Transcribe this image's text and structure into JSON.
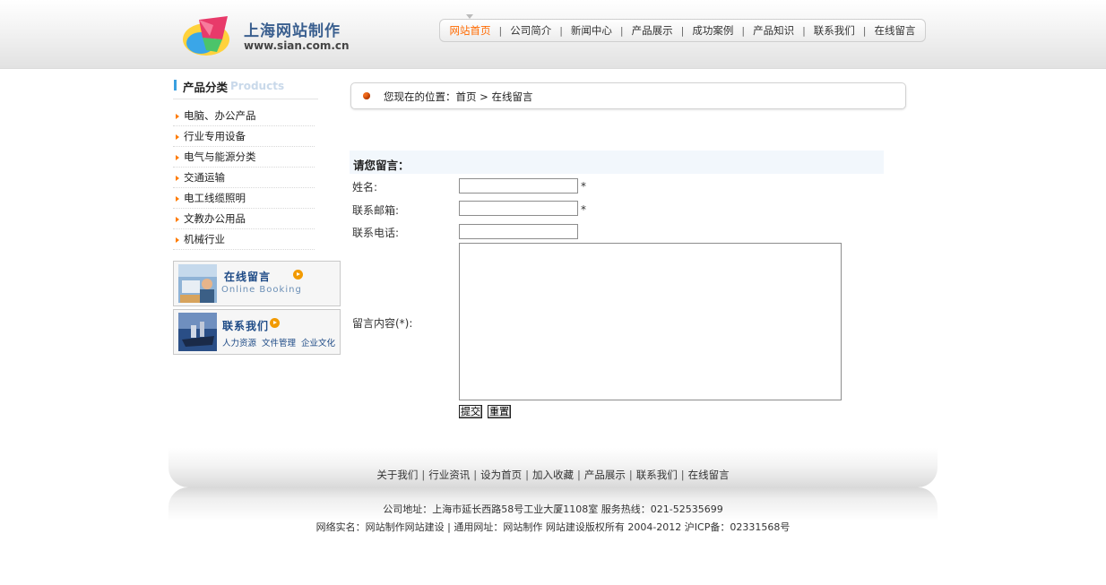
{
  "brand": {
    "title": "上海网站制作",
    "url": "www.sian.com.cn"
  },
  "nav": {
    "items": [
      {
        "label": "网站首页",
        "active": true
      },
      {
        "label": "公司简介"
      },
      {
        "label": "新闻中心"
      },
      {
        "label": "产品展示"
      },
      {
        "label": "成功案例"
      },
      {
        "label": "产品知识"
      },
      {
        "label": "联系我们"
      },
      {
        "label": "在线留言"
      }
    ],
    "separator": "|"
  },
  "sidebar": {
    "heading": "产品分类",
    "heading_en": "Products",
    "categories": [
      "电脑、办公产品",
      "行业专用设备",
      "电气与能源分类",
      "交通运输",
      "电工线缆照明",
      "文教办公用品",
      "机械行业"
    ],
    "promo_booking": {
      "title": "在线留言",
      "subtitle": "Online Booking"
    },
    "promo_contact": {
      "title": "联系我们",
      "links": [
        "人力资源",
        "文件管理",
        "企业文化"
      ]
    }
  },
  "breadcrumb": {
    "prefix": "您现在的位置：",
    "home": "首页",
    "arrow": ">",
    "current": "在线留言"
  },
  "form": {
    "heading": "请您留言：",
    "name_label": "姓名:",
    "email_label": "联系邮箱:",
    "phone_label": "联系电话:",
    "content_label": "留言内容(*):",
    "required_mark": "*",
    "name_value": "",
    "email_value": "",
    "phone_value": "",
    "content_value": "",
    "submit_label": "提交",
    "reset_label": "重置"
  },
  "footer": {
    "links": [
      "关于我们",
      "行业资讯",
      "设为首页",
      "加入收藏",
      "产品展示",
      "联系我们",
      "在线留言"
    ],
    "separator": "|",
    "address_line": "公司地址：上海市延长西路58号工业大厦1108室 服务热线：021-52535699",
    "copyright_line": "网络实名：网站制作网站建设 | 通用网址：网站制作 网站建设版权所有 2004-2012 沪ICP备：02331568号"
  },
  "colors": {
    "nav_active": "#ff6a00",
    "accent_bar": "#3aa0e0",
    "bullet": "#ff7b00",
    "promo_title": "#1d4a86"
  }
}
